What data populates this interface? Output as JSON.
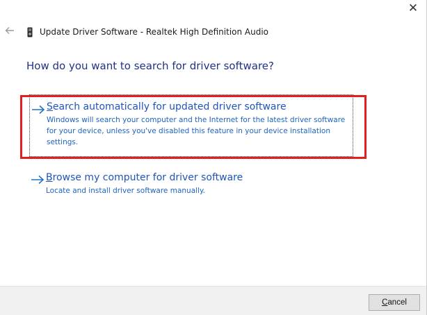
{
  "window": {
    "close_glyph": "✕",
    "back_icon": "back-arrow-icon",
    "device_icon": "audio-device-icon",
    "title": "Update Driver Software - Realtek High Definition Audio"
  },
  "heading": "How do you want to search for driver software?",
  "options": [
    {
      "title_first": "S",
      "title_rest": "earch automatically for updated driver software",
      "description": "Windows will search your computer and the Internet for the latest driver software for your device, unless you've disabled this feature in your device installation settings.",
      "focused": true,
      "highlighted": true
    },
    {
      "title_first": "B",
      "title_rest": "rowse my computer for driver software",
      "description": "Locate and install driver software manually.",
      "focused": false,
      "highlighted": false
    }
  ],
  "footer": {
    "cancel_first": "C",
    "cancel_rest": "ancel"
  },
  "colors": {
    "heading": "#1e3287",
    "link": "#1f55b8",
    "arrow": "#1f74c9",
    "highlight": "#e02020",
    "footer_bg": "#f0f0f0"
  }
}
